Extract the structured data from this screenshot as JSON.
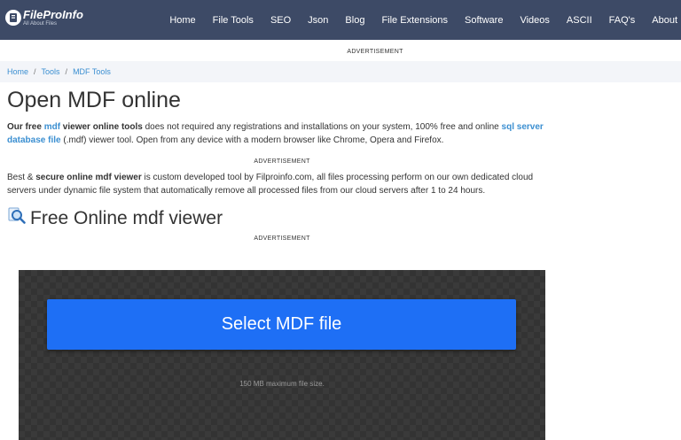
{
  "brand": {
    "name": "FileProInfo",
    "tagline": "All About Files"
  },
  "nav": {
    "items": [
      "Home",
      "File Tools",
      "SEO",
      "Json",
      "Blog",
      "File Extensions",
      "Software",
      "Videos",
      "ASCII",
      "FAQ's",
      "About"
    ]
  },
  "ads": {
    "label": "ADVERTISEMENT"
  },
  "breadcrumb": {
    "items": [
      "Home",
      "Tools",
      "MDF Tools"
    ],
    "separator": "/"
  },
  "page": {
    "title": "Open MDF online"
  },
  "intro": {
    "part1": "Our free ",
    "link1": "mdf",
    "part2": " viewer online tools",
    "part3": " does not required any registrations and installations on your system, 100% free and online ",
    "link2": "sql server database file",
    "part4": " (.mdf) viewer tool. Open from any device with a modern browser like Chrome, Opera and Firefox."
  },
  "security": {
    "part1": "Best & ",
    "bold1": "secure online mdf viewer",
    "part2": " is custom developed tool by Filproinfo.com, all files processing perform on our own dedicated cloud servers under dynamic file system that automatically remove all processed files from our cloud servers after 1 to 24 hours."
  },
  "section": {
    "heading": "Free Online mdf viewer",
    "icon": "magnifier-icon"
  },
  "uploader": {
    "button_label": "Select MDF file",
    "size_note": "150 MB maximum file size."
  },
  "colors": {
    "navbar": "#3d4a66",
    "link": "#3b8fd1",
    "button": "#1e6ff5",
    "uploader_bg": "#3a3a3a"
  }
}
